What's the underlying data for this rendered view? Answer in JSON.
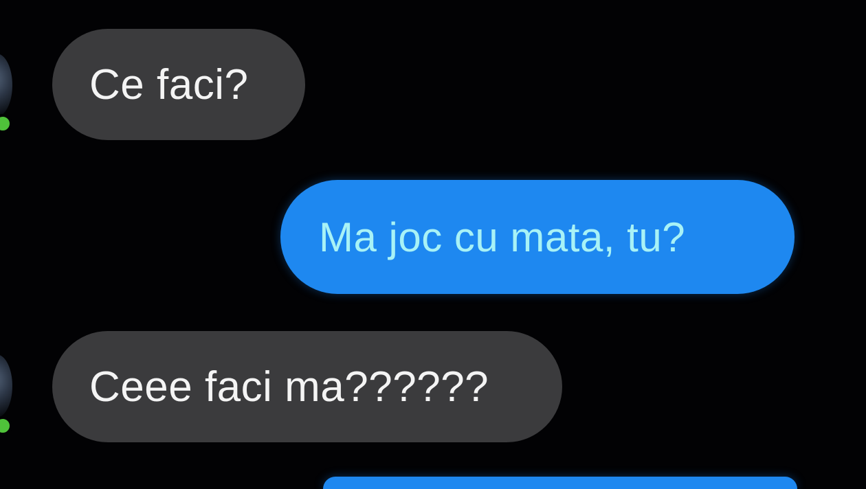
{
  "conversation": {
    "messages": [
      {
        "direction": "incoming",
        "text": "Ce faci?"
      },
      {
        "direction": "outgoing",
        "text": "Ma joc cu mata, tu?"
      },
      {
        "direction": "incoming",
        "text": "Ceee faci ma??????"
      },
      {
        "direction": "outgoing",
        "text": ""
      }
    ]
  },
  "colors": {
    "background": "#020204",
    "incoming_bubble": "#3b3b3d",
    "incoming_text": "#f4f4f4",
    "outgoing_bubble": "#1e88f0",
    "outgoing_text": "#a8f2f6",
    "presence": "#4fc23a"
  }
}
